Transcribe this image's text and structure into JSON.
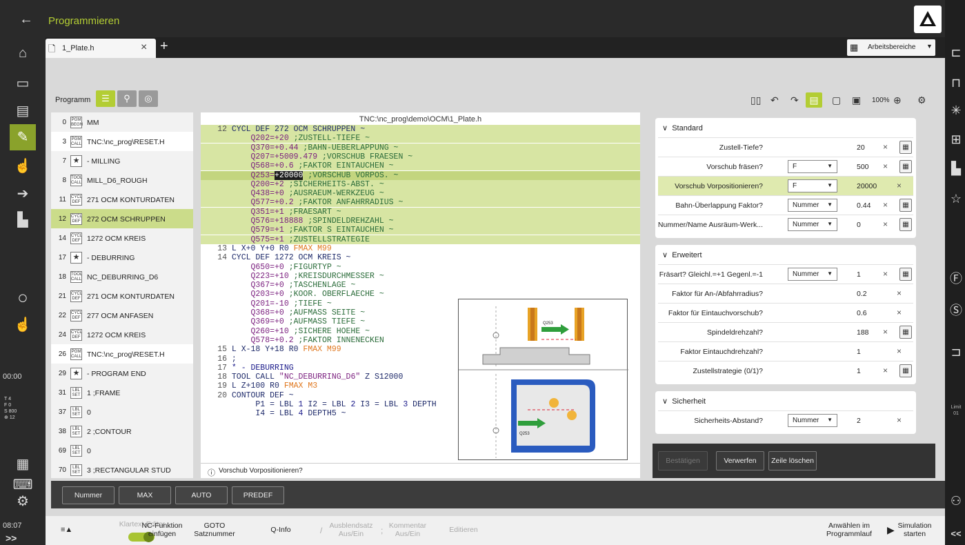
{
  "header": {
    "title": "Programmieren",
    "back_icon": "arrow-left-icon"
  },
  "tabs": [
    {
      "label": "1_Plate.h"
    }
  ],
  "workspace_label": "Arbeitsbereiche",
  "toolbar": {
    "program_label": "Programm",
    "zoom": "100%"
  },
  "left_bar": {
    "time": "00:00",
    "clock": "08:07",
    "readout": {
      "t": "T",
      "t_val": "4",
      "f": "F",
      "f_val": "0",
      "s": "S",
      "s_val": "800",
      "h_val": "12"
    },
    "more": ">>"
  },
  "right_bar": {
    "limit": "Limit",
    "limit_val": "01",
    "more": "<<"
  },
  "structure": [
    {
      "num": "0",
      "icon": "PGM BEGN",
      "label": "MM",
      "style": "grey"
    },
    {
      "num": "3",
      "icon": "PGM CALL",
      "label": "TNC:\\nc_prog\\RESET.H",
      "style": "white"
    },
    {
      "num": "7",
      "icon": "★",
      "label": "- MILLING",
      "style": "grey",
      "star": true
    },
    {
      "num": "8",
      "icon": "TOOL CALL",
      "label": "MILL_D6_ROUGH",
      "style": "grey"
    },
    {
      "num": "11",
      "icon": "CYCL DEF",
      "label": "271 OCM KONTURDATEN",
      "style": "grey"
    },
    {
      "num": "12",
      "icon": "CYCL DEF",
      "label": "272 OCM SCHRUPPEN",
      "style": "sel"
    },
    {
      "num": "14",
      "icon": "CYCL DEF",
      "label": "1272 OCM KREIS",
      "style": "grey"
    },
    {
      "num": "17",
      "icon": "★",
      "label": "- DEBURRING",
      "style": "grey",
      "star": true
    },
    {
      "num": "18",
      "icon": "TOOL CALL",
      "label": "NC_DEBURRING_D6",
      "style": "grey"
    },
    {
      "num": "21",
      "icon": "CYCL DEF",
      "label": "271 OCM KONTURDATEN",
      "style": "grey"
    },
    {
      "num": "22",
      "icon": "CYCL DEF",
      "label": "277 OCM ANFASEN",
      "style": "grey"
    },
    {
      "num": "24",
      "icon": "CYCL DEF",
      "label": "1272 OCM KREIS",
      "style": "grey"
    },
    {
      "num": "26",
      "icon": "PGM CALL",
      "label": "TNC:\\nc_prog\\RESET.H",
      "style": "white"
    },
    {
      "num": "29",
      "icon": "★",
      "label": "- PROGRAM END",
      "style": "grey",
      "star": true
    },
    {
      "num": "31",
      "icon": "LBL SET",
      "label": "1 ;FRAME",
      "style": "grey"
    },
    {
      "num": "37",
      "icon": "LBL SET",
      "label": "0",
      "style": "grey"
    },
    {
      "num": "38",
      "icon": "LBL SET",
      "label": "2 ;CONTOUR",
      "style": "grey"
    },
    {
      "num": "69",
      "icon": "LBL SET",
      "label": "0",
      "style": "grey"
    },
    {
      "num": "70",
      "icon": "LBL SET",
      "label": "3 ;RECTANGULAR STUD",
      "style": "grey"
    }
  ],
  "editor": {
    "path": "TNC:\\nc_prog\\demo\\OCM\\1_Plate.h",
    "lines": [
      {
        "hl": "hl",
        "n": "12",
        "parts": [
          [
            "k",
            " CYCL DEF 272 OCM SCHRUPPEN ~"
          ]
        ]
      },
      {
        "hl": "hl",
        "n": "",
        "parts": [
          [
            "q",
            "     Q202=+20"
          ],
          [
            "c",
            " ;ZUSTELL-TIEFE ~"
          ]
        ]
      },
      {
        "hl": "hl",
        "n": "",
        "parts": [
          [
            "q",
            "     Q370=+0.44"
          ],
          [
            "c",
            " ;BAHN-UEBERLAPPUNG ~"
          ]
        ]
      },
      {
        "hl": "hl",
        "n": "",
        "parts": [
          [
            "q",
            "     Q207=+5009.479"
          ],
          [
            "c",
            " ;VORSCHUB FRAESEN ~"
          ]
        ]
      },
      {
        "hl": "hl",
        "n": "",
        "parts": [
          [
            "q",
            "     Q568=+0.6"
          ],
          [
            "c",
            " ;FAKTOR EINTAUCHEN ~"
          ]
        ]
      },
      {
        "hl": "hl2",
        "n": "",
        "parts": [
          [
            "q",
            "     Q253="
          ],
          [
            "sel",
            "+20000"
          ],
          [
            "c",
            " ;VORSCHUB VORPOS. ~"
          ]
        ]
      },
      {
        "hl": "hl",
        "n": "",
        "parts": [
          [
            "q",
            "     Q200=+2"
          ],
          [
            "c",
            " ;SICHERHEITS-ABST. ~"
          ]
        ]
      },
      {
        "hl": "hl",
        "n": "",
        "parts": [
          [
            "q",
            "     Q438=+0"
          ],
          [
            "c",
            " ;AUSRAEUM-WERKZEUG ~"
          ]
        ]
      },
      {
        "hl": "hl",
        "n": "",
        "parts": [
          [
            "q",
            "     Q577=+0.2"
          ],
          [
            "c",
            " ;FAKTOR ANFAHRRADIUS ~"
          ]
        ]
      },
      {
        "hl": "hl",
        "n": "",
        "parts": [
          [
            "q",
            "     Q351=+1"
          ],
          [
            "c",
            " ;FRAESART ~"
          ]
        ]
      },
      {
        "hl": "hl",
        "n": "",
        "parts": [
          [
            "q",
            "     Q576=+18888"
          ],
          [
            "c",
            " ;SPINDELDREHZAHL ~"
          ]
        ]
      },
      {
        "hl": "hl",
        "n": "",
        "parts": [
          [
            "q",
            "     Q579=+1"
          ],
          [
            "c",
            " ;FAKTOR S EINTAUCHEN ~"
          ]
        ]
      },
      {
        "hl": "hl",
        "n": "",
        "parts": [
          [
            "q",
            "     Q575=+1"
          ],
          [
            "c",
            " ;ZUSTELLSTRATEGIE"
          ]
        ]
      },
      {
        "hl": "",
        "n": "13",
        "parts": [
          [
            "k",
            " L X+0 Y+0 R0 "
          ],
          [
            "f",
            "FMAX M99"
          ]
        ]
      },
      {
        "hl": "",
        "n": "14",
        "parts": [
          [
            "k",
            " CYCL DEF 1272 OCM KREIS ~"
          ]
        ]
      },
      {
        "hl": "",
        "n": "",
        "parts": [
          [
            "q",
            "     Q650=+0"
          ],
          [
            "c",
            " ;FIGURTYP ~"
          ]
        ]
      },
      {
        "hl": "",
        "n": "",
        "parts": [
          [
            "q",
            "     Q223=+10"
          ],
          [
            "c",
            " ;KREISDURCHMESSER ~"
          ]
        ]
      },
      {
        "hl": "",
        "n": "",
        "parts": [
          [
            "q",
            "     Q367=+0"
          ],
          [
            "c",
            " ;TASCHENLAGE ~"
          ]
        ]
      },
      {
        "hl": "",
        "n": "",
        "parts": [
          [
            "q",
            "     Q203=+0"
          ],
          [
            "c",
            " ;KOOR. OBERFLAECHE ~"
          ]
        ]
      },
      {
        "hl": "",
        "n": "",
        "parts": [
          [
            "q",
            "     Q201=-10"
          ],
          [
            "c",
            " ;TIEFE ~"
          ]
        ]
      },
      {
        "hl": "",
        "n": "",
        "parts": [
          [
            "q",
            "     Q368=+0"
          ],
          [
            "c",
            " ;AUFMASS SEITE ~"
          ]
        ]
      },
      {
        "hl": "",
        "n": "",
        "parts": [
          [
            "q",
            "     Q369=+0"
          ],
          [
            "c",
            " ;AUFMASS TIEFE ~"
          ]
        ]
      },
      {
        "hl": "",
        "n": "",
        "parts": [
          [
            "q",
            "     Q260=+10"
          ],
          [
            "c",
            " ;SICHERE HOEHE ~"
          ]
        ]
      },
      {
        "hl": "",
        "n": "",
        "parts": [
          [
            "q",
            "     Q578=+0.2"
          ],
          [
            "c",
            " ;FAKTOR INNENECKEN"
          ]
        ]
      },
      {
        "hl": "",
        "n": "15",
        "parts": [
          [
            "k",
            " L X-18 Y+18 R0 "
          ],
          [
            "f",
            "FMAX M99"
          ]
        ]
      },
      {
        "hl": "",
        "n": "16",
        "parts": [
          [
            "k",
            " ;"
          ]
        ]
      },
      {
        "hl": "",
        "n": "17",
        "parts": [
          [
            "g",
            " * - DEBURRING"
          ]
        ]
      },
      {
        "hl": "",
        "n": "18",
        "parts": [
          [
            "k",
            " TOOL CALL "
          ],
          [
            "q",
            "\"NC_DEBURRING_D6\""
          ],
          [
            "k",
            " Z S12000"
          ]
        ]
      },
      {
        "hl": "",
        "n": "19",
        "parts": [
          [
            "k",
            " L Z+100 R0 "
          ],
          [
            "f",
            "FMAX M3"
          ]
        ]
      },
      {
        "hl": "",
        "n": "20",
        "parts": [
          [
            "k",
            " CONTOUR DEF ~"
          ]
        ]
      },
      {
        "hl": "",
        "n": "",
        "parts": [
          [
            "k",
            "      P1 = LBL "
          ],
          [
            "g",
            "1"
          ],
          [
            "k",
            " I2 = LBL "
          ],
          [
            "g",
            "2"
          ],
          [
            "k",
            " I3 = LBL "
          ],
          [
            "g",
            "3"
          ],
          [
            "k",
            " DEPTH"
          ]
        ]
      },
      {
        "hl": "",
        "n": "",
        "parts": [
          [
            "k",
            "      I4 = LBL "
          ],
          [
            "g",
            "4"
          ],
          [
            "k",
            " DEPTH5 ~"
          ]
        ]
      }
    ],
    "status": "Vorschub Vorpositionieren?",
    "help_label_1": "Q253",
    "help_label_2": "Q253"
  },
  "form": {
    "sections": [
      {
        "title": "Standard",
        "rows": [
          {
            "label": "Zustell-Tiefe?",
            "select": "",
            "value": "20",
            "calc": true
          },
          {
            "label": "Vorschub fräsen?",
            "select": "F",
            "value": "500",
            "calc": true
          },
          {
            "label": "Vorschub Vorpositionieren?",
            "select": "F",
            "value": "20000",
            "calc": false,
            "hl": true
          },
          {
            "label": "Bahn-Überlappung Faktor?",
            "select": "Nummer",
            "value": "0.44",
            "calc": true
          },
          {
            "label": "Nummer/Name Ausräum-Werk...",
            "select": "Nummer",
            "value": "0",
            "calc": true
          }
        ]
      },
      {
        "title": "Erweitert",
        "rows": [
          {
            "label": "Fräsart? Gleichl.=+1 Gegenl.=-1",
            "select": "Nummer",
            "value": "1",
            "calc": true
          },
          {
            "label": "Faktor für An-/Abfahrradius?",
            "select": "",
            "value": "0.2",
            "calc": false
          },
          {
            "label": "Faktor für Eintauchvorschub?",
            "select": "",
            "value": "0.6",
            "calc": false
          },
          {
            "label": "Spindeldrehzahl?",
            "select": "",
            "value": "188",
            "calc": true
          },
          {
            "label": "Faktor Eintauchdrehzahl?",
            "select": "",
            "value": "1",
            "calc": false
          },
          {
            "label": "Zustellstrategie (0/1)?",
            "select": "",
            "value": "1",
            "calc": true
          }
        ]
      },
      {
        "title": "Sicherheit",
        "rows": [
          {
            "label": "Sicherheits-Abstand?",
            "select": "Nummer",
            "value": "2",
            "calc": false
          }
        ]
      }
    ],
    "actions": {
      "confirm": "Bestätigen",
      "discard": "Verwerfen",
      "delete": "Zeile löschen"
    }
  },
  "softkeys": [
    "Nummer",
    "MAX",
    "AUTO",
    "PREDEF"
  ],
  "bottom": {
    "menu": "≡▲",
    "klartext": "Klartext-Editor",
    "nc_func_1": "NC-Funktion",
    "nc_func_2": "einfügen",
    "goto_1": "GOTO",
    "goto_2": "Satznummer",
    "qinfo": "Q-Info",
    "skip_1": "Ausblendsatz",
    "skip_2": "Aus/Ein",
    "comment_1": "Kommentar",
    "comment_2": "Aus/Ein",
    "edit": "Editieren",
    "select_1": "Anwählen im",
    "select_2": "Programmlauf",
    "sim_1": "Simulation",
    "sim_2": "starten"
  },
  "colors": {
    "accent": "#b3cd34",
    "highlight": "#d7e5a3",
    "dark": "#2a2a2a"
  }
}
